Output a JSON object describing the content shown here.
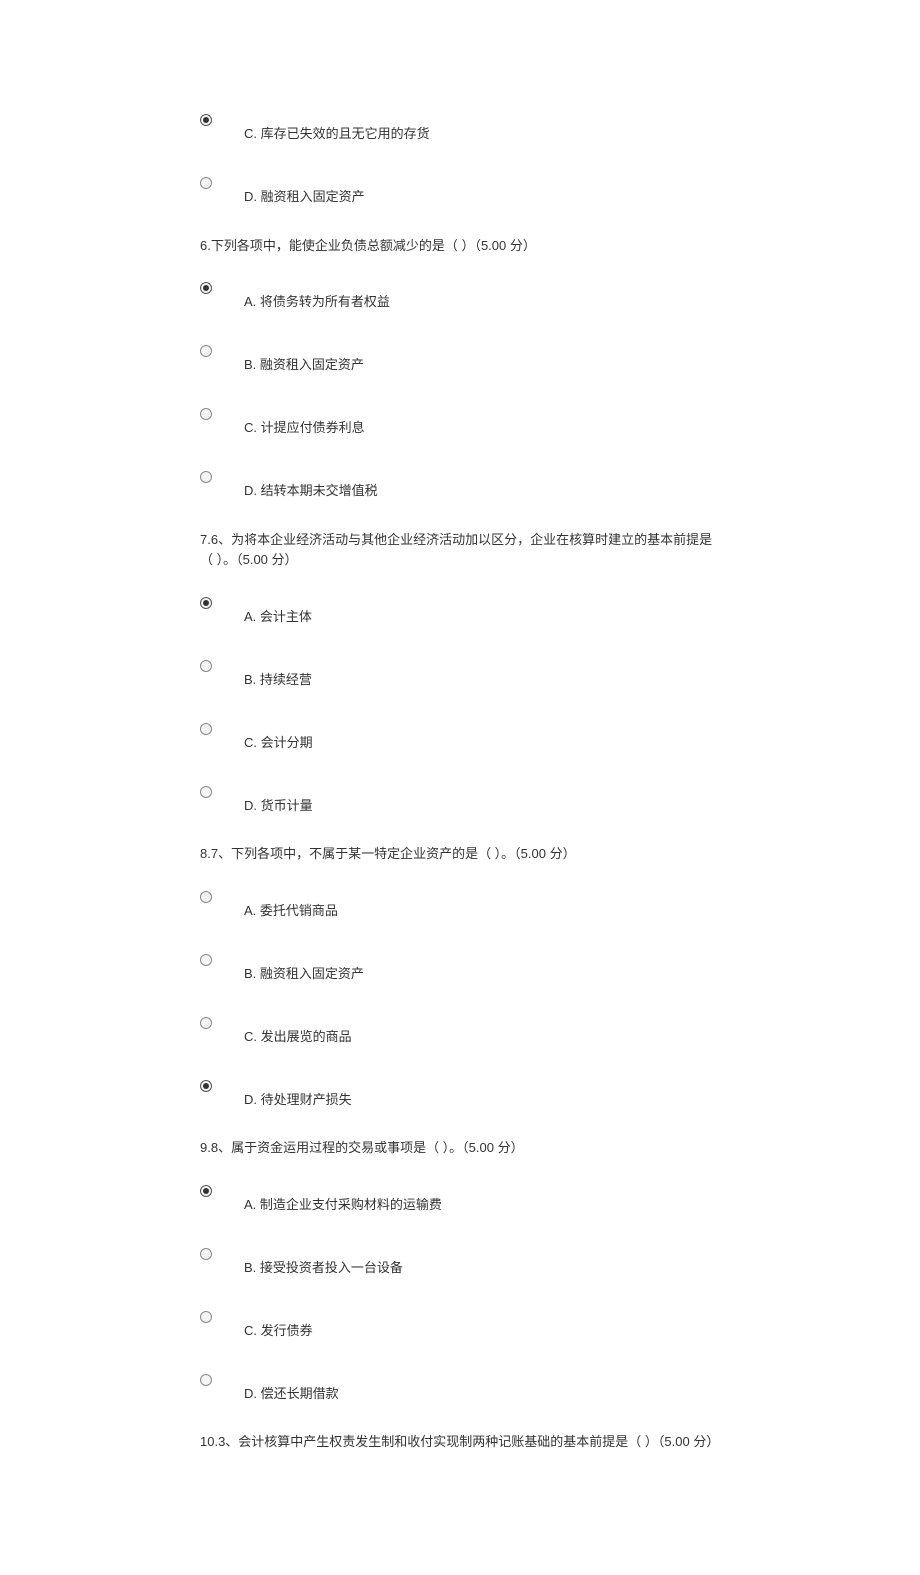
{
  "questions": [
    {
      "prefix_options": [
        {
          "label": "C. 库存已失效的且无它用的存货",
          "selected": true
        },
        {
          "label": "D.  融资租入固定资产",
          "selected": false
        }
      ],
      "text": "6.下列各项中，能使企业负债总额减少的是（  ）（5.00 分）",
      "options": [
        {
          "label": "A. 将债务转为所有者权益",
          "selected": true
        },
        {
          "label": "B. 融资租入固定资产",
          "selected": false
        },
        {
          "label": "C. 计提应付债券利息",
          "selected": false
        },
        {
          "label": "D. 结转本期未交增值税",
          "selected": false
        }
      ]
    },
    {
      "text": "7.6、为将本企业经济活动与其他企业经济活动加以区分，企业在核算时建立的基本前提是（  ）。（5.00 分）",
      "options": [
        {
          "label": "A. 会计主体",
          "selected": true
        },
        {
          "label": "B. 持续经营",
          "selected": false
        },
        {
          "label": "C. 会计分期",
          "selected": false
        },
        {
          "label": "D. 货币计量",
          "selected": false
        }
      ]
    },
    {
      "text": "8.7、下列各项中，不属于某一特定企业资产的是（  ）。（5.00 分）",
      "options": [
        {
          "label": "A. 委托代销商品",
          "selected": false
        },
        {
          "label": "B. 融资租入固定资产",
          "selected": false
        },
        {
          "label": "C. 发出展览的商品",
          "selected": false
        },
        {
          "label": "D. 待处理财产损失",
          "selected": true
        }
      ]
    },
    {
      "text": "9.8、属于资金运用过程的交易或事项是（   ）。（5.00 分）",
      "options": [
        {
          "label": "A. 制造企业支付采购材料的运输费",
          "selected": true
        },
        {
          "label": "B. 接受投资者投入一台设备",
          "selected": false
        },
        {
          "label": "C. 发行债券",
          "selected": false
        },
        {
          "label": "D. 偿还长期借款",
          "selected": false
        }
      ]
    },
    {
      "text": "10.3、会计核算中产生权责发生制和收付实现制两种记账基础的基本前提是（  ）（5.00 分）",
      "options": []
    }
  ]
}
